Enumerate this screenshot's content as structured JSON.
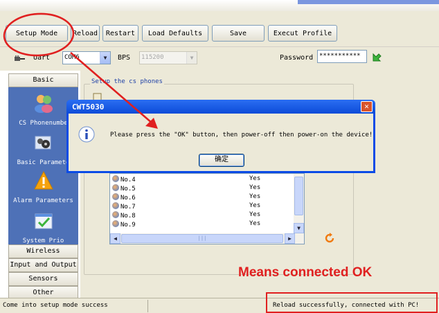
{
  "toolbar": {
    "buttons": [
      "Setup Mode",
      "Reload",
      "Restart",
      "Load Defaults",
      "Save",
      "Execut Profile"
    ]
  },
  "uart": {
    "label": "Uart",
    "port_value": "COM6",
    "bps_label": "BPS",
    "bps_value": "115200",
    "password_label": "Password",
    "password_value": "***********"
  },
  "sidebar": {
    "top_tab": "Basic",
    "items": [
      {
        "label": "CS Phonenumbe",
        "icon": "people-icon"
      },
      {
        "label": "Basic Paramete",
        "icon": "gears-icon"
      },
      {
        "label": "Alarm Parameters",
        "icon": "warning-icon"
      },
      {
        "label": "System Prio",
        "icon": "checklist-icon"
      }
    ],
    "bottom_tabs": [
      "Wireless",
      "Input and Output",
      "Sensors",
      "Other"
    ]
  },
  "main": {
    "group_title": "Setup the cs phones",
    "phone_rows": [
      {
        "name": "No.4",
        "enabled": "Yes"
      },
      {
        "name": "No.5",
        "enabled": "Yes"
      },
      {
        "name": "No.6",
        "enabled": "Yes"
      },
      {
        "name": "No.7",
        "enabled": "Yes"
      },
      {
        "name": "No.8",
        "enabled": "Yes"
      },
      {
        "name": "No.9",
        "enabled": "Yes"
      }
    ],
    "scroll_grip": "|||"
  },
  "dialog": {
    "title": "CWT5030",
    "message": "Please press the \"OK\" button, then power-off then power-on the device!",
    "ok_button": "确定",
    "close_glyph": "✕"
  },
  "annotation": "Means connected OK",
  "status": {
    "left": "Come into setup mode success",
    "right": "Reload successfully, connected with PC!"
  },
  "colors": {
    "annotation_red": "#e02020",
    "sidebar_blue": "#4e71b7",
    "dialog_blue": "#0a4be6",
    "window_face": "#ece9d8"
  }
}
